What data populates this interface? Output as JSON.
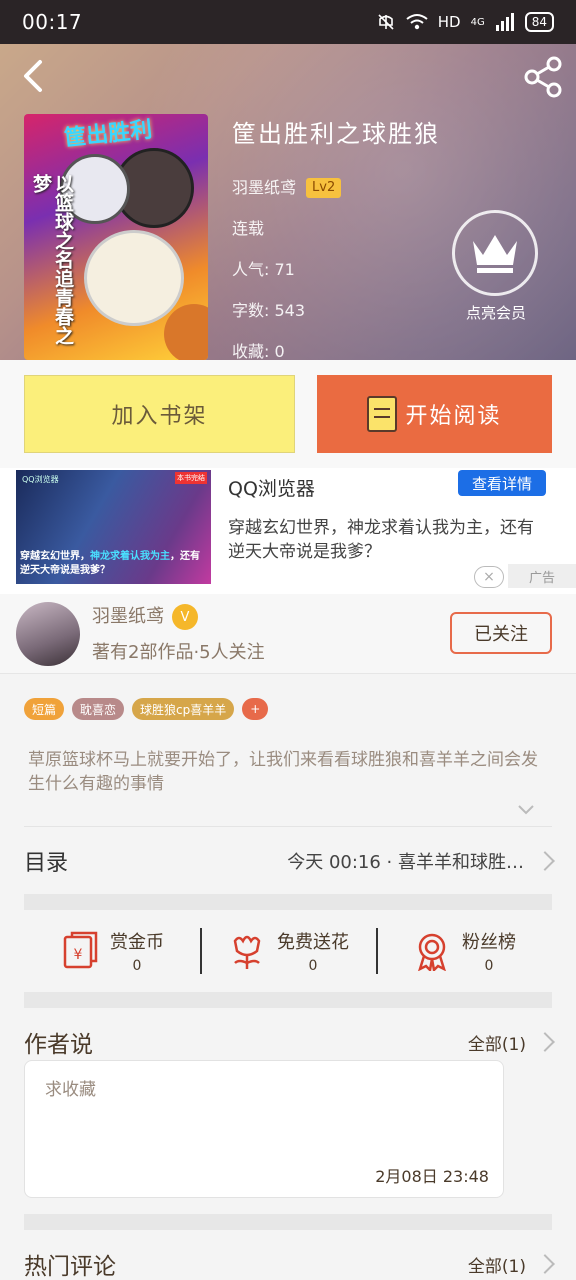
{
  "status_bar": {
    "time": "00:17",
    "network": "HD",
    "signal": "4G",
    "battery": "84"
  },
  "header": {
    "back_icon": "back-arrow-icon",
    "share_icon": "share-icon"
  },
  "book": {
    "title": "筐出胜利之球胜狼",
    "author": "羽墨纸鸢",
    "author_level": "Lv2",
    "status": "连载",
    "popularity": "人气: 71",
    "word_count": "字数: 543",
    "favorites": "收藏: 0",
    "cover_title": "筐出胜利",
    "cover_side_text": "以篮球之名追青春之梦"
  },
  "vip": {
    "label": "点亮会员",
    "icon": "crown-icon"
  },
  "buttons": {
    "add_shelf": "加入书架",
    "start_read": "开始阅读"
  },
  "ad": {
    "title": "QQ浏览器",
    "detail_button": "查看详情",
    "description": "穿越玄幻世界，神龙求着认我为主，还有逆天大帝说是我爹？",
    "image_text_1": "穿越玄幻世界，",
    "image_text_highlight": "神龙求着认我为主",
    "image_text_2": "，还有逆天大帝说是我爹？",
    "image_logo": "QQ浏览器",
    "image_tag": "本书完结",
    "close": "×",
    "label": "广告"
  },
  "author": {
    "name": "羽墨纸鸢",
    "verified": "V",
    "stats": "著有2部作品·5人关注",
    "follow_button": "已关注"
  },
  "tags": [
    {
      "label": "短篇",
      "color": "#f0a23a"
    },
    {
      "label": "耽喜恋",
      "color": "#b88a8a"
    },
    {
      "label": "球胜狼cp喜羊羊",
      "color": "#d6a64a"
    },
    {
      "label": "+",
      "color": "#e76a4a"
    }
  ],
  "summary": "草原篮球杯马上就要开始了，让我们来看看球胜狼和喜羊羊之间会发生什么有趣的事情",
  "toc": {
    "label": "目录",
    "latest": "今天 00:16 · 喜羊羊和球胜…"
  },
  "actions": [
    {
      "label": "赏金币",
      "count": "0",
      "icon": "coin-envelope-icon"
    },
    {
      "label": "免费送花",
      "count": "0",
      "icon": "flower-icon"
    },
    {
      "label": "粉丝榜",
      "count": "0",
      "icon": "medal-icon"
    }
  ],
  "author_says": {
    "title": "作者说",
    "all": "全部(1)",
    "text": "求收藏",
    "time": "2月08日  23:48"
  },
  "hot_comments": {
    "title": "热门评论",
    "all": "全部(1)"
  },
  "colors": {
    "accent": "#ea6b41",
    "shelf": "#fbef7b",
    "ad_button": "#1c6ee6"
  }
}
